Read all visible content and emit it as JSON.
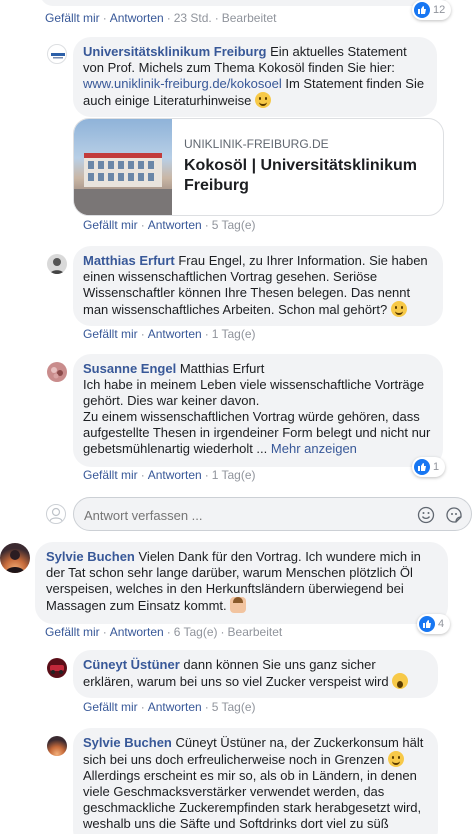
{
  "top_actions": {
    "like": "Gefällt mir",
    "reply": "Antworten",
    "time": "23 Std.",
    "edited": "Bearbeitet",
    "like_count": "12"
  },
  "comments": [
    {
      "author": "Universitätsklinikum Freiburg",
      "text_1": "Ein aktuelles Statement von Prof. Michels zum Thema Kokosöl finden Sie hier:",
      "link": "www.uniklinik-freiburg.de/kokosoel",
      "text_2": "Im Statement finden Sie auch einige Literaturhinweise",
      "link_preview": {
        "domain": "UNIKLINIK-FREIBURG.DE",
        "title": "Kokosöl | Universitätsklinikum Freiburg"
      },
      "actions": {
        "like": "Gefällt mir",
        "reply": "Antworten",
        "time": "5 Tag(e)"
      }
    },
    {
      "author": "Matthias Erfurt",
      "text": "Frau Engel, zu Ihrer Information. Sie haben einen wissenschaftlichen Vortrag gesehen. Seriöse Wissenschaftler können Ihre Thesen belegen. Das nennt man wissenschaftliches Arbeiten. Schon mal gehört?",
      "actions": {
        "like": "Gefällt mir",
        "reply": "Antworten",
        "time": "1 Tag(e)"
      }
    },
    {
      "author": "Susanne Engel",
      "mention": "Matthias Erfurt",
      "text_1": "Ich habe in meinem Leben viele wissenschaftliche Vorträge gehört. Dies war keiner davon.",
      "text_2": "Zu einem wissenschaftlichen Vortrag würde gehören, dass aufgestellte Thesen in irgendeiner Form belegt und nicht nur gebetsmühlenartig wiederholt ...",
      "more": "Mehr anzeigen",
      "like_count": "1",
      "actions": {
        "like": "Gefällt mir",
        "reply": "Antworten",
        "time": "1 Tag(e)"
      }
    }
  ],
  "reply_box": {
    "placeholder": "Antwort verfassen ..."
  },
  "thread2": {
    "author": "Sylvie Buchen",
    "text": "Vielen Dank für den Vortrag. Ich wundere mich in der Tat schon sehr lange darüber, warum Menschen plötzlich Öl verspeisen, welches in den Herkunftsländern überwiegend bei Massagen zum Einsatz kommt.",
    "like_count": "4",
    "actions": {
      "like": "Gefällt mir",
      "reply": "Antworten",
      "time": "6 Tag(e)",
      "edited": "Bearbeitet"
    },
    "replies": [
      {
        "author": "Cüneyt Üstüner",
        "text": "dann können Sie uns ganz sicher erklären, warum bei uns so viel Zucker verspeist wird",
        "actions": {
          "like": "Gefällt mir",
          "reply": "Antworten",
          "time": "5 Tag(e)"
        }
      },
      {
        "author": "Sylvie Buchen",
        "mention": "Cüneyt Üstüner",
        "text_1": "na, der Zuckerkonsum hält sich bei uns doch erfreulicherweise noch in Grenzen",
        "text_2": "Allerdings erscheint es mir so, als ob in Ländern, in denen viele Geschmacksverstärker verwendet werden, das geschmackliche Zuckerempfinden stark herabgesetzt wird, weshalb uns die Säfte und Softdrinks dort viel zu süß"
      }
    ]
  },
  "colors": {
    "link": "#385898",
    "bubble": "#f2f3f5",
    "like_blue": "#1877f2",
    "meta": "#90949c"
  }
}
